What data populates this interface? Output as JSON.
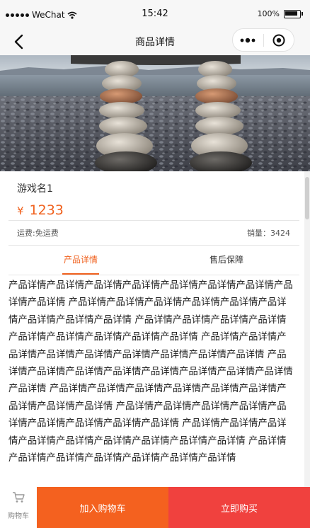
{
  "status_bar": {
    "carrier": "WeChat",
    "time": "15:42",
    "battery_percent": "100%"
  },
  "nav": {
    "title": "商品详情"
  },
  "product": {
    "name": "游戏名1",
    "currency_symbol": "¥",
    "price": "1233",
    "shipping": "运费:免运费",
    "sales": "销量：3424"
  },
  "tabs": [
    {
      "label": "产品详情",
      "active": true
    },
    {
      "label": "售后保障",
      "active": false
    }
  ],
  "detail_text": "产品详情产品详情产品详情产品详情产品详情产品详情产品详情产品详情产品详情 产品详情产品详情产品详情产品详情产品详情产品详情产品详情产品详情产品详情 产品详情产品详情产品详情产品详情产品详情产品详情产品详情产品详情产品详情 产品详情产品详情产品详情产品详情产品详情产品详情产品详情产品详情产品详情 产品详情产品详情产品详情产品详情产品详情产品详情产品详情产品详情产品详情 产品详情产品详情产品详情产品详情产品详情产品详情产品详情产品详情产品详情 产品详情产品详情产品详情产品详情产品详情产品详情产品详情产品详情产品详情 产品详情产品详情产品详情产品详情产品详情产品详情产品详情产品详情产品详情 产品详情产品详情产品详情产品详情产品详情产品详情产品详情",
  "bottom_bar": {
    "cart_label": "购物车",
    "add_to_cart": "加入购物车",
    "buy_now": "立即购买"
  },
  "colors": {
    "accent": "#f0621f",
    "add_cart_bg": "#f4611f",
    "buy_now_bg": "#f0413e"
  },
  "icons": [
    "signal-dots-icon",
    "wifi-icon",
    "battery-icon",
    "back-arrow-icon",
    "more-dots-icon",
    "close-target-icon",
    "cart-icon"
  ]
}
